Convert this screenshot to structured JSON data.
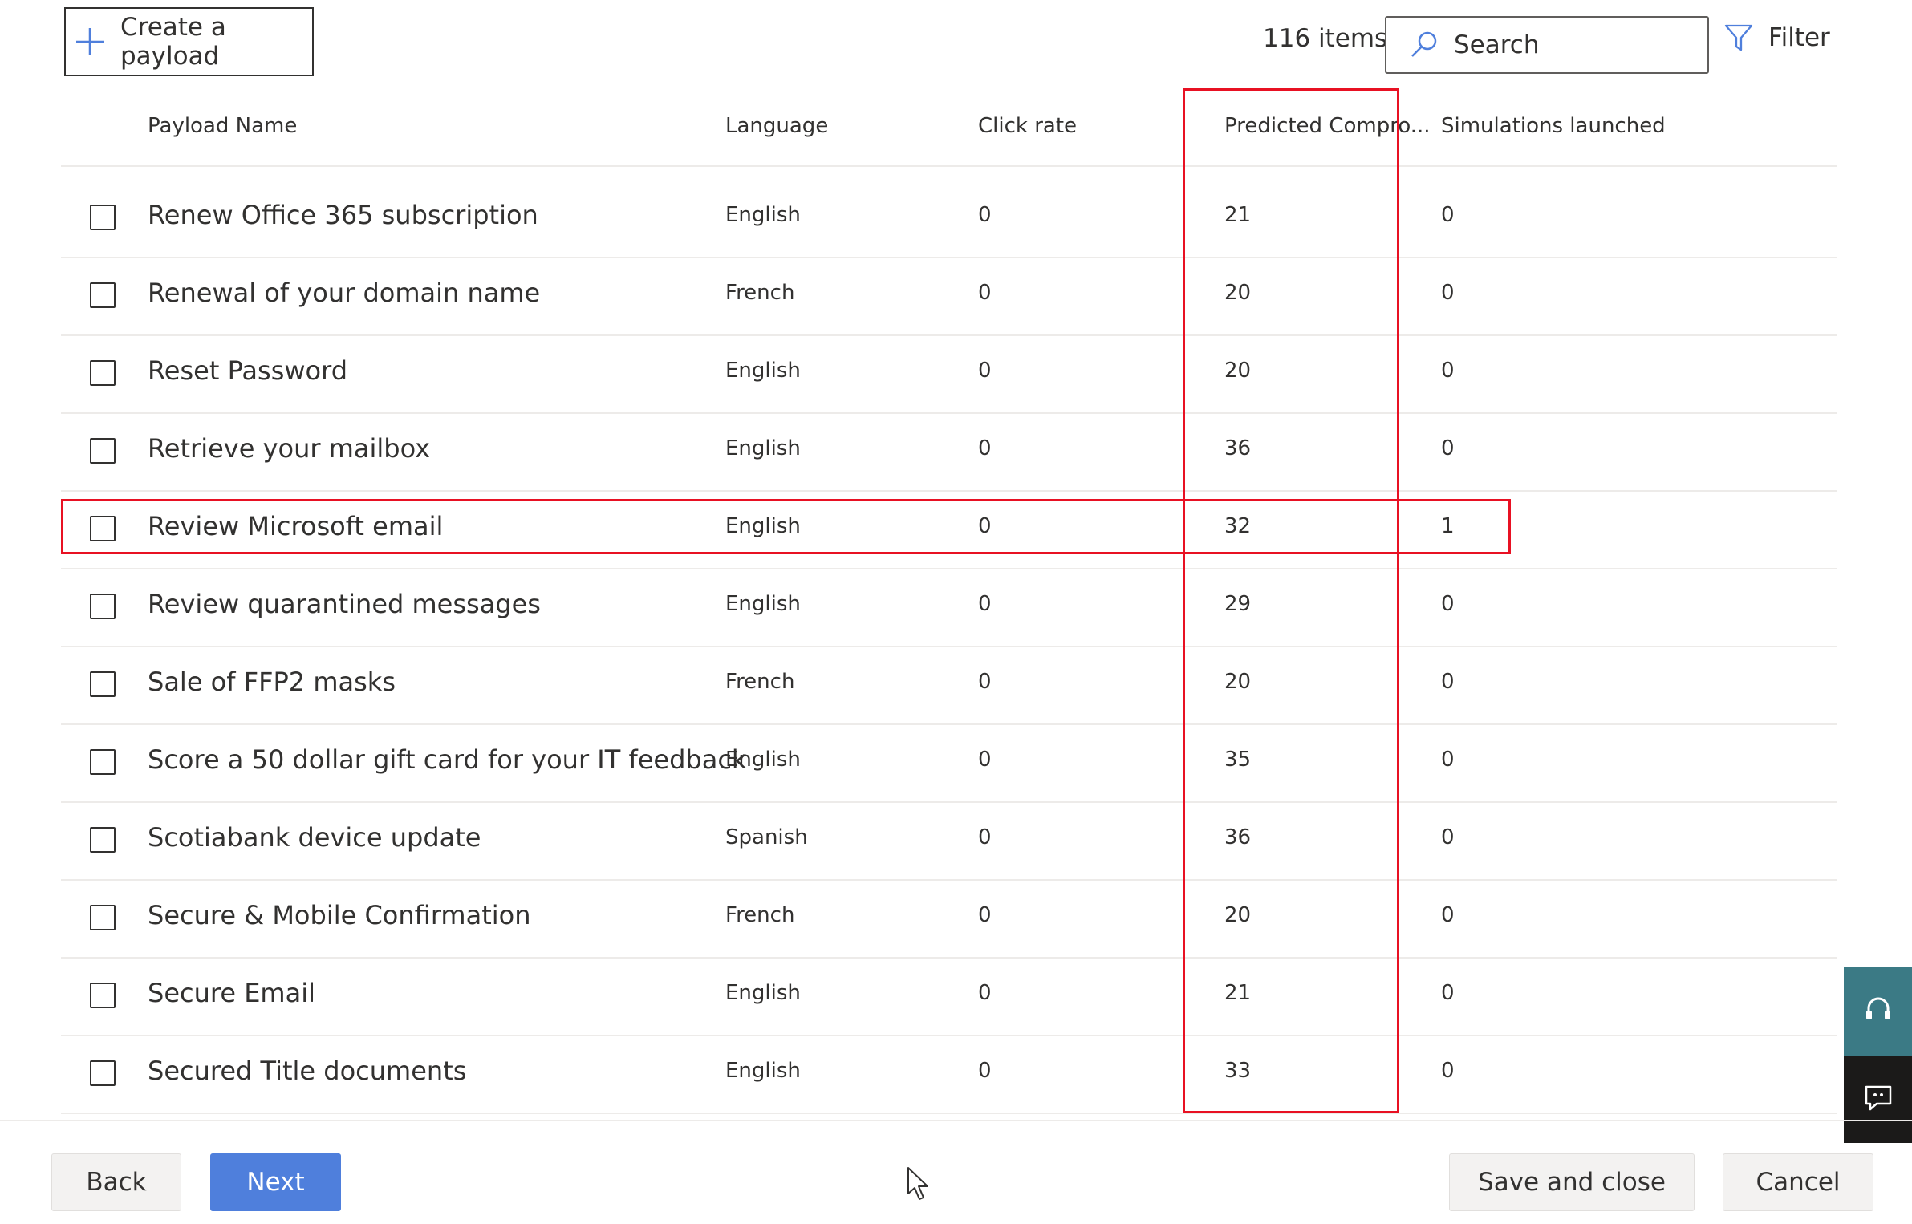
{
  "toolbar": {
    "create_label": "Create a payload",
    "items_count": "116 items",
    "search_placeholder": "Search",
    "filter_label": "Filter"
  },
  "table": {
    "columns": {
      "name": "Payload Name",
      "language": "Language",
      "click_rate": "Click rate",
      "predicted": "Predicted Compro...",
      "simulations": "Simulations launched"
    },
    "rows": [
      {
        "name": "Renew Office 365 subscription",
        "language": "English",
        "click_rate": "0",
        "predicted": "21",
        "simulations": "0"
      },
      {
        "name": "Renewal of your domain name",
        "language": "French",
        "click_rate": "0",
        "predicted": "20",
        "simulations": "0"
      },
      {
        "name": "Reset Password",
        "language": "English",
        "click_rate": "0",
        "predicted": "20",
        "simulations": "0"
      },
      {
        "name": "Retrieve your mailbox",
        "language": "English",
        "click_rate": "0",
        "predicted": "36",
        "simulations": "0"
      },
      {
        "name": "Review Microsoft email",
        "language": "English",
        "click_rate": "0",
        "predicted": "32",
        "simulations": "1"
      },
      {
        "name": "Review quarantined messages",
        "language": "English",
        "click_rate": "0",
        "predicted": "29",
        "simulations": "0"
      },
      {
        "name": "Sale of FFP2 masks",
        "language": "French",
        "click_rate": "0",
        "predicted": "20",
        "simulations": "0"
      },
      {
        "name": "Score a 50 dollar gift card for your IT feedback",
        "language": "English",
        "click_rate": "0",
        "predicted": "35",
        "simulations": "0"
      },
      {
        "name": "Scotiabank device update",
        "language": "Spanish",
        "click_rate": "0",
        "predicted": "36",
        "simulations": "0"
      },
      {
        "name": "Secure & Mobile Confirmation",
        "language": "French",
        "click_rate": "0",
        "predicted": "20",
        "simulations": "0"
      },
      {
        "name": "Secure Email",
        "language": "English",
        "click_rate": "0",
        "predicted": "21",
        "simulations": "0"
      },
      {
        "name": "Secured Title documents",
        "language": "English",
        "click_rate": "0",
        "predicted": "33",
        "simulations": "0"
      }
    ]
  },
  "footer": {
    "back_label": "Back",
    "next_label": "Next",
    "save_close_label": "Save and close",
    "cancel_label": "Cancel"
  },
  "colors": {
    "accent": "#4f7fdc",
    "highlight": "#e81123",
    "help_tab": "#3b7a85",
    "feedback_tab": "#1b1a19"
  },
  "icons": [
    "plus-icon",
    "search-icon",
    "filter-icon",
    "headset-icon",
    "feedback-icon",
    "mouse-cursor-icon"
  ]
}
